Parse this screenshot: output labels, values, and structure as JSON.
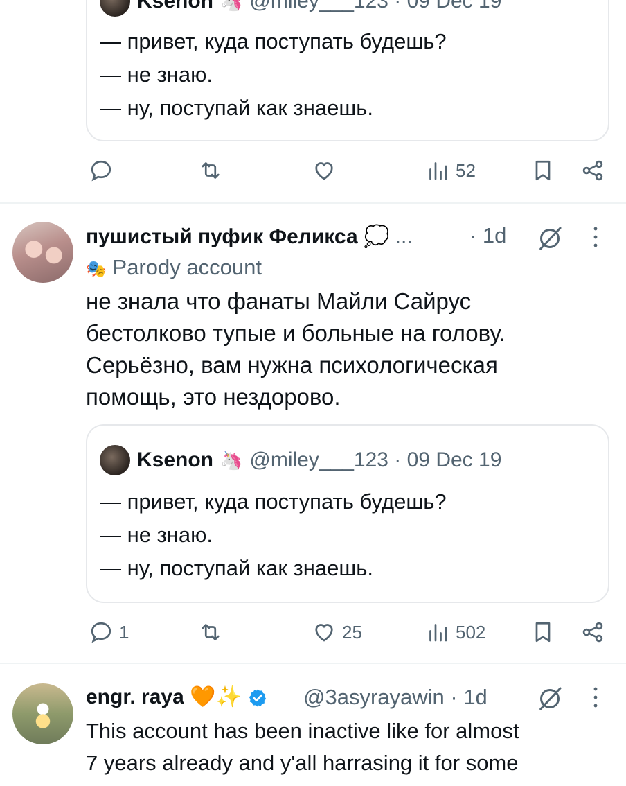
{
  "tweet_top_partial": {
    "quote": {
      "author_name": "Ksenon",
      "author_emoji": "🦄",
      "handle_date": "@miley___123 · 09 Dec 19",
      "lines": [
        "— привет, куда поступать будешь?",
        "— не знаю.",
        "— ну, поступай как знаешь."
      ]
    },
    "actions": {
      "reply_count": "",
      "retweet_count": "",
      "like_count": "",
      "views_count": "52"
    }
  },
  "tweet_main": {
    "author_name": "пушистый пуфик Феликса",
    "author_emoji": "💭",
    "ellipsis": "...",
    "time": "· 1d",
    "parody_icon": "🎭",
    "parody_label": "Parody account",
    "body_lines": [
      "не знала что фанаты Майли Сайрус",
      "бестолково тупые и больные на голову.",
      "Серьёзно, вам нужна психологическая",
      "помощь, это нездорово."
    ],
    "quote": {
      "author_name": "Ksenon",
      "author_emoji": "🦄",
      "handle_date": "@miley___123 · 09 Dec 19",
      "lines": [
        "— привет, куда поступать будешь?",
        "— не знаю.",
        "— ну, поступай как знаешь."
      ]
    },
    "actions": {
      "reply_count": "1",
      "retweet_count": "",
      "like_count": "25",
      "views_count": "502"
    }
  },
  "tweet_bottom": {
    "author_name": "engr. raya",
    "author_emoji": "🧡✨",
    "handle_time": "@3asyrayawin · 1d",
    "body_lines": [
      "This account has been inactive like for almost",
      "7 years already and y'all harrasing it for some"
    ]
  },
  "colors": {
    "text": "#0f1419",
    "secondary": "#536471",
    "border": "#e6e8eb",
    "verified": "#1d9bf0"
  }
}
